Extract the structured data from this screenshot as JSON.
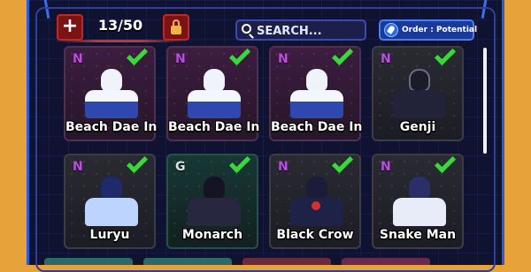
{
  "header": {
    "add_label": "+",
    "capacity": "13/50",
    "search_placeholder": "SEARCH...",
    "order_label": "Order : Potential"
  },
  "units": [
    {
      "name": "Beach Dae In",
      "rarity": "N",
      "checked": true,
      "theme": "pink",
      "figure": "white"
    },
    {
      "name": "Beach Dae In",
      "rarity": "N",
      "checked": true,
      "theme": "pink",
      "figure": "white"
    },
    {
      "name": "Beach Dae In",
      "rarity": "N",
      "checked": true,
      "theme": "pink",
      "figure": "white"
    },
    {
      "name": "Genji",
      "rarity": "N",
      "checked": true,
      "theme": "grey",
      "figure": "dark"
    },
    {
      "name": "Luryu",
      "rarity": "N",
      "checked": true,
      "theme": "grey",
      "figure": "blue"
    },
    {
      "name": "Monarch",
      "rarity": "G",
      "checked": true,
      "theme": "teal",
      "figure": "monarch"
    },
    {
      "name": "Black Crow",
      "rarity": "N",
      "checked": true,
      "theme": "grey",
      "figure": "crow"
    },
    {
      "name": "Snake Man",
      "rarity": "N",
      "checked": true,
      "theme": "grey",
      "figure": "snake"
    }
  ],
  "colors": {
    "background": "#e8a23a",
    "panel": "#0f1230",
    "accent_blue": "#3c6cf0",
    "accent_red": "#c02828",
    "check_green": "#3ed640",
    "rarity_n": "#c04ae8"
  }
}
